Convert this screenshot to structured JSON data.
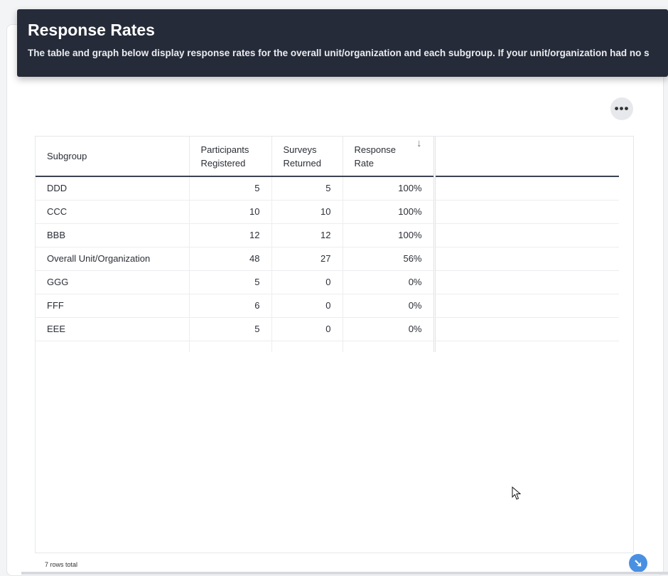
{
  "header": {
    "title": "Response Rates",
    "description": "The table and graph below display response rates for the overall unit/organization and each subgroup. If your unit/organization had no s"
  },
  "more_button": {
    "icon": "more-horizontal-icon",
    "label": "•••"
  },
  "table": {
    "columns": [
      {
        "label": "Subgroup"
      },
      {
        "label": "Participants Registered"
      },
      {
        "label": "Surveys Returned"
      },
      {
        "label": "Response Rate",
        "sort_icon": "↓"
      }
    ],
    "rows": [
      {
        "subgroup": "DDD",
        "registered": "5",
        "returned": "5",
        "rate": "100%"
      },
      {
        "subgroup": "CCC",
        "registered": "10",
        "returned": "10",
        "rate": "100%"
      },
      {
        "subgroup": "BBB",
        "registered": "12",
        "returned": "12",
        "rate": "100%"
      },
      {
        "subgroup": "Overall Unit/Organization",
        "registered": "48",
        "returned": "27",
        "rate": "56%"
      },
      {
        "subgroup": "GGG",
        "registered": "5",
        "returned": "0",
        "rate": "0%"
      },
      {
        "subgroup": "FFF",
        "registered": "6",
        "returned": "0",
        "rate": "0%"
      },
      {
        "subgroup": "EEE",
        "registered": "5",
        "returned": "0",
        "rate": "0%"
      }
    ],
    "footer": "7 rows total"
  },
  "scroll_button": {
    "icon": "scroll-down-icon",
    "glyph": "➘"
  },
  "colors": {
    "header_bg": "#252b38",
    "accent": "#4a90e2"
  }
}
